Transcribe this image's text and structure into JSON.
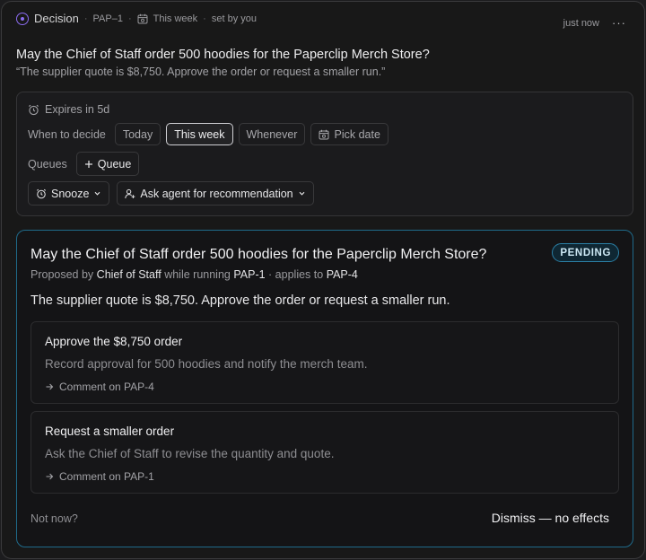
{
  "header": {
    "kind": "Decision",
    "id": "PAP–1",
    "when": "This week",
    "set_by": "set by you",
    "timestamp": "just now",
    "more": "···"
  },
  "question": {
    "title": "May the Chief of Staff order 500 hoodies for the Paperclip Merch Store?",
    "subtitle": "“The supplier quote is $8,750. Approve the order or request a smaller run.”"
  },
  "panel": {
    "expires": "Expires in 5d",
    "when_label": "When to decide",
    "when_options": [
      "Today",
      "This week",
      "Whenever",
      "Pick date"
    ],
    "when_selected": "This week",
    "queues_label": "Queues",
    "queue_button": "Queue",
    "snooze_button": "Snooze",
    "ask_button": "Ask agent for recommendation"
  },
  "card": {
    "title": "May the Chief of Staff order 500 hoodies for the Paperclip Merch Store?",
    "status": "PENDING",
    "proposed_prefix": "Proposed by",
    "proposer": "Chief of Staff",
    "while_running": "while running",
    "running_ref": "PAP-1",
    "applies_to": "· applies to",
    "applies_ref": "PAP-4",
    "description": "The supplier quote is $8,750. Approve the order or request a smaller run.",
    "options": [
      {
        "title": "Approve the $8,750 order",
        "description": "Record approval for 500 hoodies and notify the merch team.",
        "link": "Comment on PAP-4"
      },
      {
        "title": "Request a smaller order",
        "description": "Ask the Chief of Staff to revise the quantity and quote.",
        "link": "Comment on PAP-1"
      }
    ],
    "not_now": "Not now?",
    "dismiss": "Dismiss — no effects"
  },
  "colors": {
    "accent": "#8b6cf0",
    "pending_border": "#2b7fa5",
    "card_border": "#1f6a8a"
  }
}
